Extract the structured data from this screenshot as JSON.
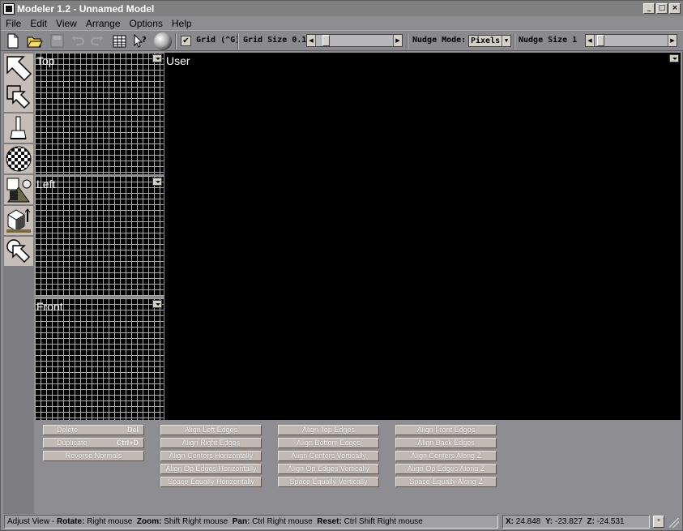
{
  "window": {
    "title": "Modeler 1.2 - Unnamed Model",
    "min": "_",
    "max": "□",
    "close": "×"
  },
  "menu": [
    "File",
    "Edit",
    "View",
    "Arrange",
    "Options",
    "Help"
  ],
  "toolbar": {
    "grid_label": "Grid (^G)",
    "grid_checked": true,
    "grid_size_label": "Grid Size 0.10",
    "nudge_mode_label": "Nudge Mode:",
    "nudge_mode_value": "Pixels",
    "nudge_size_label": "Nudge Size 1"
  },
  "views": {
    "top": "Top",
    "left": "Left",
    "front": "Front",
    "user": "User"
  },
  "edit_buttons": {
    "delete": {
      "label": "Delete",
      "key": "Del"
    },
    "duplicate": {
      "label": "Duplicate",
      "key": "Ctrl+D"
    },
    "reverse_normals": "Reverse Normals"
  },
  "align_x": [
    "Align Left Edges",
    "Align Right Edges",
    "Align Centers Horizontally",
    "Align Op Edges Horizontally",
    "Space Equally Horizontally"
  ],
  "align_y": [
    "Align Top Edges",
    "Align Bottom Edges",
    "Align Centers Vertically",
    "Align Op Edges Vertically",
    "Space Equally Vertically"
  ],
  "align_z": [
    "Align Front Edges",
    "Align Back Edges",
    "Align Centers Along Z",
    "Align Op Edges Along Z",
    "Space Equally Along Z"
  ],
  "status": {
    "mode": "Adjust View - ",
    "rotate_label": "Rotate:",
    "rotate_value": "Right mouse",
    "zoom_label": "Zoom:",
    "zoom_value": "Shift Right mouse",
    "pan_label": "Pan:",
    "pan_value": "Ctrl Right mouse",
    "reset_label": "Reset:",
    "reset_value": "Ctrl Shift Right mouse",
    "x_label": "X:",
    "x": "24.848",
    "y_label": "Y:",
    "y": "-23.827",
    "z_label": "Z:",
    "z": "-24.531",
    "minus": "-"
  }
}
